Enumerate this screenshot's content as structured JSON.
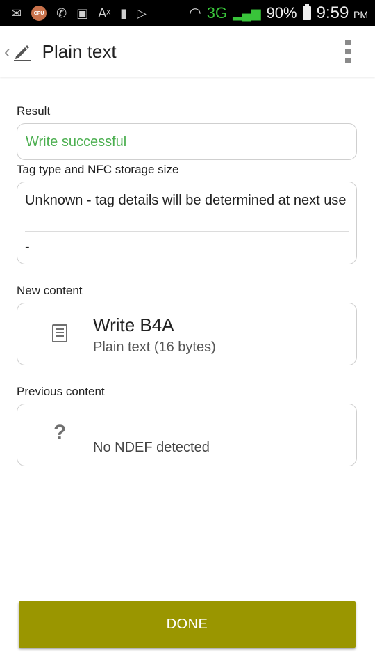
{
  "status_bar": {
    "network": "3G",
    "battery": "90%",
    "time": "9:59",
    "ampm": "PM",
    "cpu_label": "CPU"
  },
  "toolbar": {
    "title": "Plain text",
    "icons": [
      "back-chevron-icon",
      "pencil-icon",
      "overflow-menu-icon"
    ]
  },
  "result": {
    "label": "Result",
    "value": "Write successful",
    "value_color": "#4caf50"
  },
  "tag": {
    "label": "Tag type and NFC storage size",
    "type_text": "Unknown - tag details will be determined at next use",
    "size_text": "-"
  },
  "new_content": {
    "label": "New content",
    "title": "Write B4A",
    "subtitle": "Plain text (16 bytes)",
    "icon": "document-icon"
  },
  "previous_content": {
    "label": "Previous content",
    "icon_glyph": "?",
    "text": "No NDEF detected"
  },
  "done_button": {
    "label": "DONE",
    "color": "#9a9600"
  }
}
